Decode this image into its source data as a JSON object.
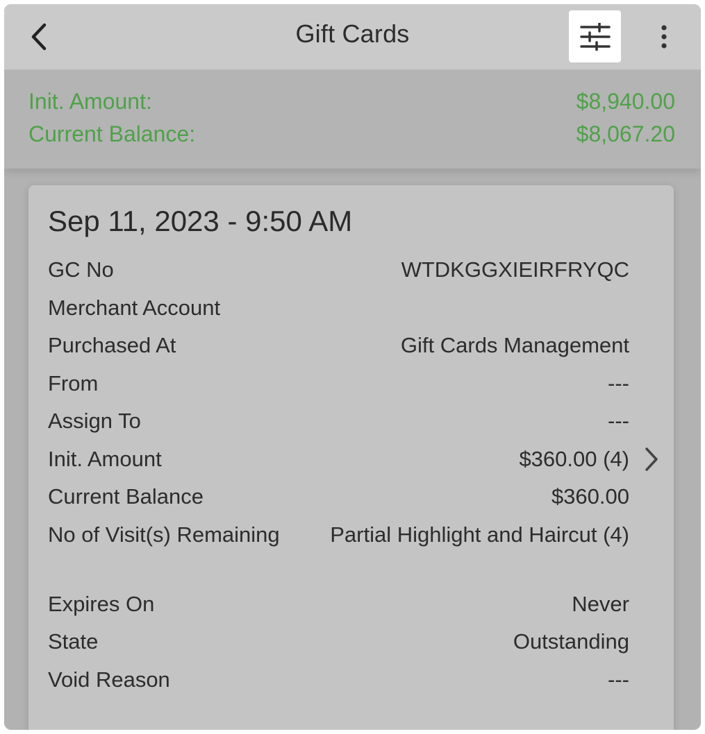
{
  "header": {
    "title": "Gift Cards",
    "back_icon": "chevron-left-icon",
    "filter_icon": "sliders-icon",
    "more_icon": "more-vertical-icon"
  },
  "summary": {
    "init_amount_label": "Init. Amount:",
    "init_amount_value": "$8,940.00",
    "current_balance_label": "Current Balance:",
    "current_balance_value": "$8,067.20",
    "accent_color": "#4fa14a"
  },
  "card": {
    "date": "Sep 11, 2023 - 9:50 AM",
    "rows": [
      {
        "label": "GC No",
        "value": "WTDKGGXIEIRFRYQC"
      },
      {
        "label": "Merchant Account",
        "value": ""
      },
      {
        "label": "Purchased At",
        "value": "Gift Cards Management"
      },
      {
        "label": "From",
        "value": "---"
      },
      {
        "label": "Assign To",
        "value": "---"
      },
      {
        "label": "Init. Amount",
        "value": "$360.00 (4)"
      },
      {
        "label": "Current Balance",
        "value": "$360.00"
      },
      {
        "label": "No of Visit(s) Remaining",
        "value": "Partial Highlight and Haircut (4)"
      },
      {
        "label": "Expires On",
        "value": "Never"
      },
      {
        "label": "State",
        "value": "Outstanding"
      },
      {
        "label": "Void Reason",
        "value": "---"
      }
    ]
  }
}
